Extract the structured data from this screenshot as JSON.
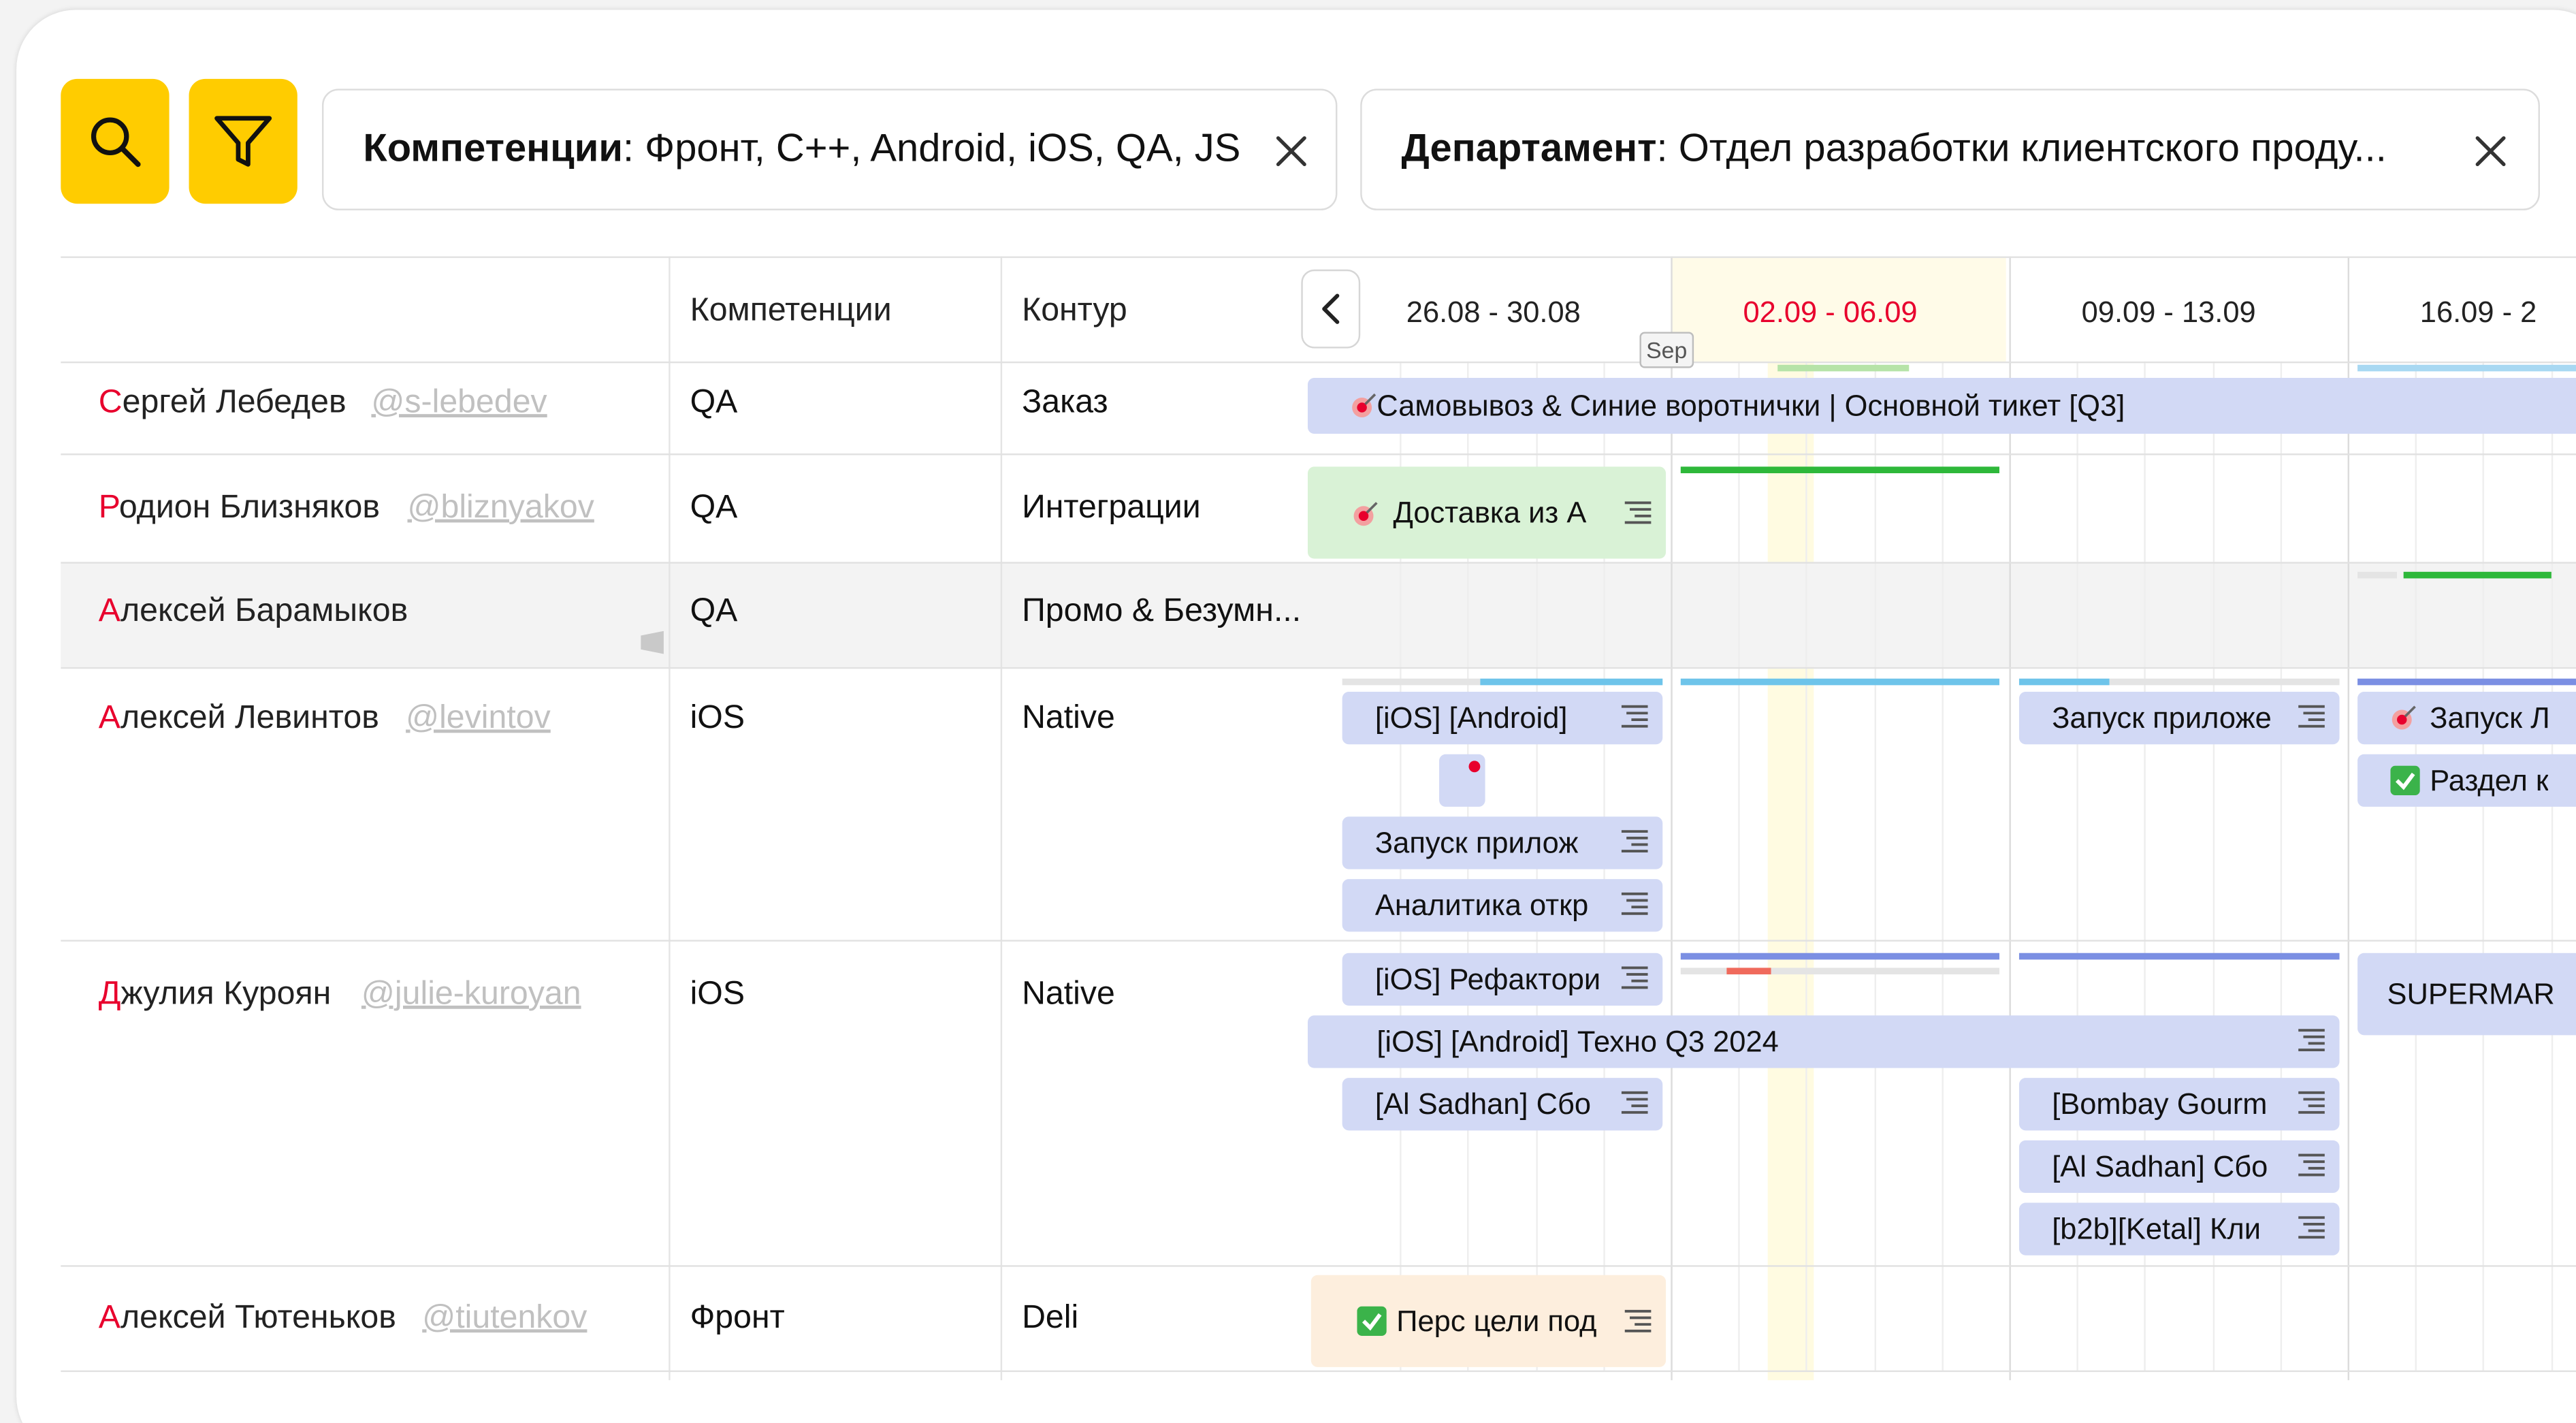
{
  "filters": {
    "competencies_label": "Компетенции",
    "competencies_value": ": Фронт, C++, Android, iOS, QA, JS",
    "department_label": "Департамент",
    "department_value": ": Отдел разработки клиентского проду..."
  },
  "table": {
    "col_competencies": "Компетенции",
    "col_contour": "Контур",
    "weeks": [
      "26.08 - 30.08",
      "02.09 - 06.09",
      "09.09 - 13.09",
      "16.09 - 2"
    ],
    "month_marker": "Sep"
  },
  "rows": [
    {
      "first": "С",
      "rest": "ергей Лебедев",
      "login": "@s-lebedev",
      "competency": "QA",
      "contour": "Заказ"
    },
    {
      "first": "Р",
      "rest": "одион Близняков",
      "login": "@bliznyakov",
      "competency": "QA",
      "contour": "Интеграции"
    },
    {
      "first": "А",
      "rest": "лексей Барамыков",
      "login": "",
      "competency": "QA",
      "contour": "Промо & Безумн..."
    },
    {
      "first": "А",
      "rest": "лексей Левинтов",
      "login": "@levintov",
      "competency": "iOS",
      "contour": "Native"
    },
    {
      "first": "Д",
      "rest": "жулия Куроян",
      "login": "@julie-kuroyan",
      "competency": "iOS",
      "contour": "Native"
    },
    {
      "first": "А",
      "rest": "лексей Тютеньков",
      "login": "@tiutenkov",
      "competency": "Фронт",
      "contour": "Deli"
    }
  ],
  "tasks": {
    "t1": "Самовывоз & Синие воротнички | Основной тикет [Q3]",
    "t2": "Доставка из А",
    "t3": "[iOS] [Android]",
    "t4": "Запуск приложе",
    "t5": "Запуск прилож",
    "t6": "Аналитика откр",
    "t7": "Запуск Л",
    "t8": "Раздел к",
    "t9": "[iOS] Рефактори",
    "t10": "[iOS] [Android] Техно Q3 2024",
    "t11": "SUPERMAR",
    "t12": "[Al Sadhan] Сбо",
    "t13": "[Bombay Gourm",
    "t14": "[Al Sadhan] Сбо",
    "t15": "[b2b][Ketal] Кли",
    "t16": "Перс цели под"
  },
  "colors": {
    "accent_yellow": "#ffcc00",
    "name_first_letter": "#e8002d",
    "current_week": "#e8002d",
    "task_blue": "#d2d9f5",
    "task_green": "#d9f2d6",
    "task_peach": "#fdeedd",
    "progress_green": "#2eb83a",
    "progress_cyan": "#6ec4ea",
    "progress_blue": "#7b8fe3",
    "progress_red": "#f06a5c"
  },
  "icons": [
    "search-icon",
    "filter-icon",
    "close-icon",
    "chevron-left-icon",
    "target-icon",
    "checkbox-icon",
    "lines-icon"
  ]
}
